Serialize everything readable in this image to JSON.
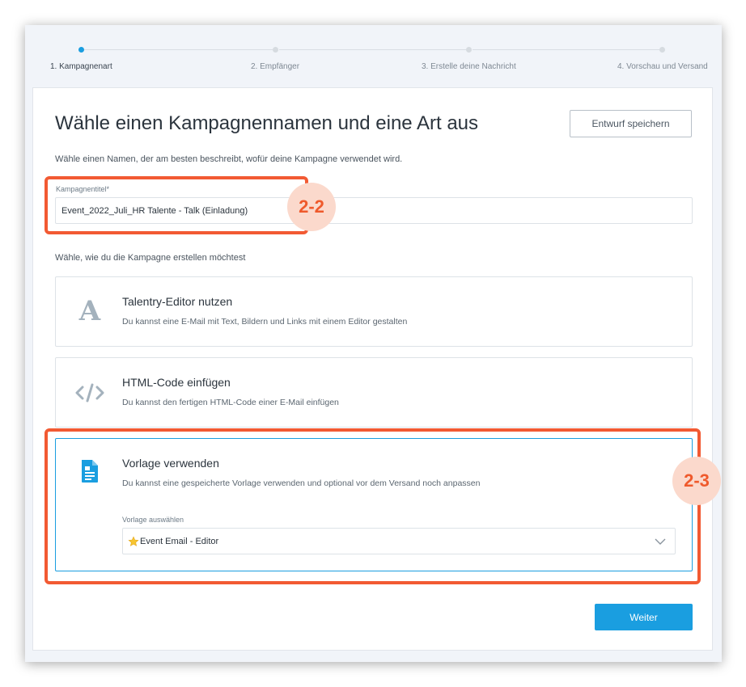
{
  "stepper": {
    "steps": [
      {
        "label": "1. Kampagnenart",
        "active": true
      },
      {
        "label": "2. Empfänger",
        "active": false
      },
      {
        "label": "3. Erstelle deine Nachricht",
        "active": false
      },
      {
        "label": "4. Vorschau und Versand",
        "active": false
      }
    ]
  },
  "header": {
    "title": "Wähle einen Kampagnennamen und eine Art aus",
    "save_draft_label": "Entwurf speichern"
  },
  "form": {
    "intro": "Wähle einen Namen, der am besten beschreibt, wofür deine Kampagne verwendet wird.",
    "title_label": "Kampagnentitel*",
    "title_value": "Event_2022_Juli_HR Talente - Talk (Einladung)",
    "method_prompt": "Wähle, wie du die Kampagne erstellen möchtest"
  },
  "options": [
    {
      "title": "Talentry-Editor nutzen",
      "description": "Du kannst eine E-Mail mit Text, Bildern und Links mit einem Editor gestalten",
      "icon": "letter-a-icon",
      "selected": false
    },
    {
      "title": "HTML-Code einfügen",
      "description": "Du kannst den fertigen HTML-Code einer E-Mail einfügen",
      "icon": "code-icon",
      "selected": false
    },
    {
      "title": "Vorlage verwenden",
      "description": "Du kannst eine gespeicherte Vorlage verwenden und optional vor dem Versand noch anpassen",
      "icon": "document-icon",
      "selected": true,
      "template_label": "Vorlage auswählen",
      "template_value": "Event Email - Editor",
      "template_icon": "star-icon"
    }
  ],
  "footer": {
    "next_label": "Weiter"
  },
  "annotations": {
    "badge_1": "2-2",
    "badge_2": "2-3"
  },
  "colors": {
    "accent": "#1a9ee0",
    "highlight": "#f25a33",
    "badge_bg": "#fbd9cc"
  }
}
